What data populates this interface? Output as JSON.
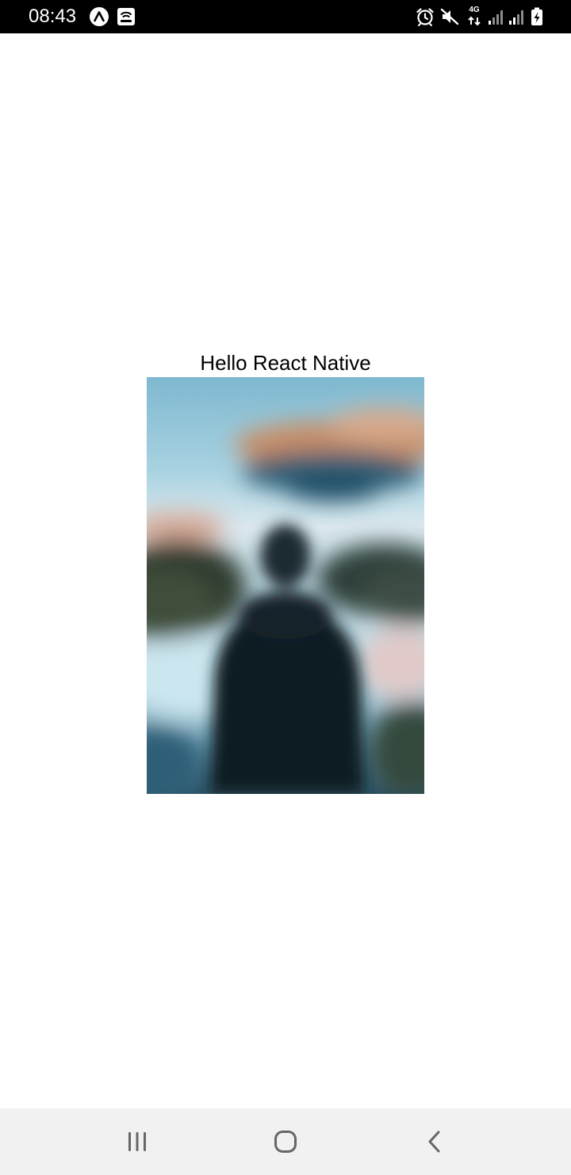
{
  "status_bar": {
    "time": "08:43",
    "left_icons": [
      "expo-go-icon",
      "wifi-calling-icon"
    ],
    "right_icons": [
      "alarm-icon",
      "mute-icon",
      "network-4g-icon",
      "signal-1-icon",
      "signal-2-icon",
      "battery-charging-icon"
    ],
    "network_type": "4G"
  },
  "main": {
    "greeting": "Hello React Native",
    "image": {
      "description_icon": "blurred-photo-person-lake",
      "colors": {
        "sky": "#8cc2d6",
        "cloud": "#c9906a",
        "person": "#13232c",
        "water": "#a9d6e6"
      }
    }
  },
  "nav_bar": {
    "buttons": [
      "recent-apps-icon",
      "home-icon",
      "back-icon"
    ],
    "background": "#f1f1f1"
  }
}
